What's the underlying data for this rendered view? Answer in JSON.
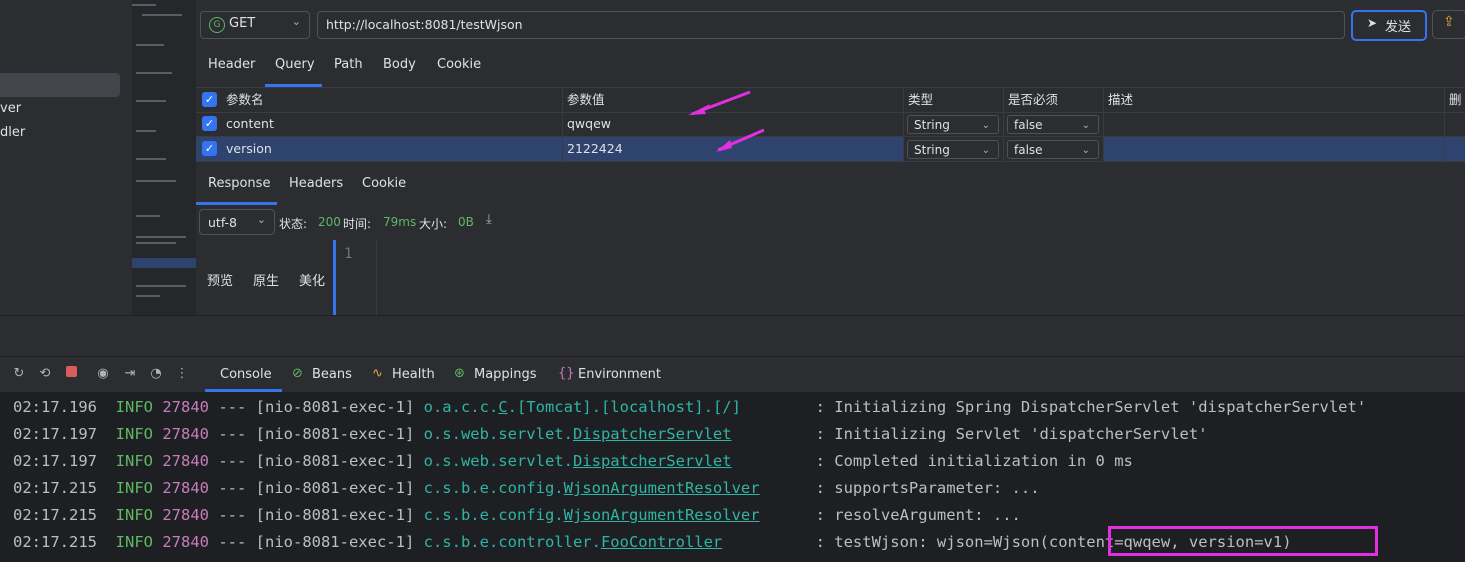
{
  "sidebar": {
    "items": [
      "ver",
      "dler"
    ]
  },
  "request": {
    "method": "GET",
    "method_icon": "G",
    "url": "http://localhost:8081/testWjson",
    "send_label": "发送"
  },
  "request_tabs": [
    "Header",
    "Query",
    "Path",
    "Body",
    "Cookie"
  ],
  "params": {
    "headers": [
      "参数名",
      "参数值",
      "类型",
      "是否必须",
      "描述",
      "删除"
    ],
    "rows": [
      {
        "name": "content",
        "value": "qwqew",
        "type": "String",
        "required": "false"
      },
      {
        "name": "version",
        "value": "2122424",
        "type": "String",
        "required": "false"
      }
    ]
  },
  "response_tabs": [
    "Response",
    "Headers",
    "Cookie"
  ],
  "response": {
    "encoding": "utf-8",
    "status_label": "状态:",
    "status": "200",
    "time_label": "时间:",
    "time": "79ms",
    "size_label": "大小:",
    "size": "0B",
    "views": [
      "预览",
      "原生",
      "美化"
    ],
    "line_no": "1"
  },
  "tool_tabs": [
    "Console",
    "Beans",
    "Health",
    "Mappings",
    "Environment"
  ],
  "console": {
    "lines": [
      {
        "time": "02:17.196",
        "level": "INFO",
        "pid": "27840",
        "sep": "---",
        "thread": "[nio-8081-exec-1]",
        "logger_prefix": "o.a.c.c.",
        "logger_link": "C",
        "logger_suffix": ".[Tomcat].[localhost].[/]",
        "msg": ": Initializing Spring DispatcherServlet 'dispatcherServlet'"
      },
      {
        "time": "02:17.197",
        "level": "INFO",
        "pid": "27840",
        "sep": "---",
        "thread": "[nio-8081-exec-1]",
        "logger_prefix": "o.s.web.servlet.",
        "logger_link": "DispatcherServlet",
        "logger_suffix": "",
        "msg": ": Initializing Servlet 'dispatcherServlet'"
      },
      {
        "time": "02:17.197",
        "level": "INFO",
        "pid": "27840",
        "sep": "---",
        "thread": "[nio-8081-exec-1]",
        "logger_prefix": "o.s.web.servlet.",
        "logger_link": "DispatcherServlet",
        "logger_suffix": "",
        "msg": ": Completed initialization in 0 ms"
      },
      {
        "time": "02:17.215",
        "level": "INFO",
        "pid": "27840",
        "sep": "---",
        "thread": "[nio-8081-exec-1]",
        "logger_prefix": "c.s.b.e.config.",
        "logger_link": "WjsonArgumentResolver",
        "logger_suffix": "",
        "msg": ": supportsParameter: ..."
      },
      {
        "time": "02:17.215",
        "level": "INFO",
        "pid": "27840",
        "sep": "---",
        "thread": "[nio-8081-exec-1]",
        "logger_prefix": "c.s.b.e.config.",
        "logger_link": "WjsonArgumentResolver",
        "logger_suffix": "",
        "msg": ": resolveArgument: ..."
      },
      {
        "time": "02:17.215",
        "level": "INFO",
        "pid": "27840",
        "sep": "---",
        "thread": "[nio-8081-exec-1]",
        "logger_prefix": "c.s.b.e.controller.",
        "logger_link": "FooController",
        "logger_suffix": "",
        "msg": ": testWjson: wjson=Wjson(content=qwqew, version=v1)"
      }
    ]
  },
  "colors": {
    "accent": "#3574f0",
    "highlight": "#e030e0",
    "green": "#5fb865"
  }
}
